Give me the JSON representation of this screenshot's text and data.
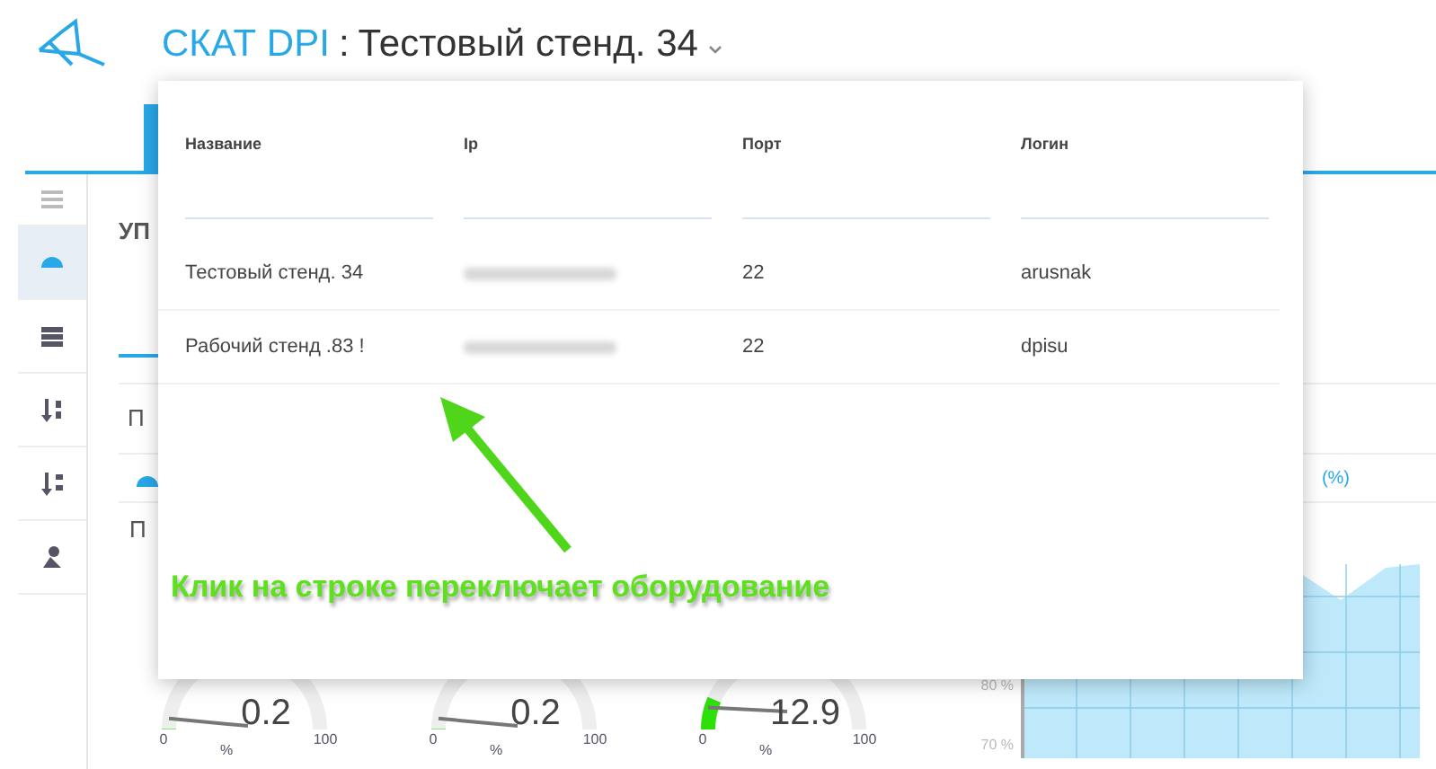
{
  "header": {
    "product": "СКАТ DPI",
    "separator": ":",
    "device": "Тестовый стенд. 34"
  },
  "sidebar": {
    "items": [
      {
        "selected": false
      },
      {
        "selected": true
      },
      {
        "selected": false
      },
      {
        "selected": false
      },
      {
        "selected": false
      },
      {
        "selected": false
      }
    ]
  },
  "page": {
    "heading": "УП",
    "subtab": "П",
    "section": "П",
    "chart_legend": "(%)",
    "gauges": [
      {
        "value": "0.2",
        "min": "0",
        "max": "100",
        "unit": "%"
      },
      {
        "value": "0.2",
        "min": "0",
        "max": "100",
        "unit": "%"
      },
      {
        "value": "12.9",
        "min": "0",
        "max": "100",
        "unit": "%"
      }
    ],
    "chart_axis_labels": [
      "80 %",
      "70 %"
    ]
  },
  "device_menu": {
    "columns": [
      "Название",
      "Ip",
      "Порт",
      "Логин"
    ],
    "rows": [
      {
        "name": "Тестовый стенд. 34",
        "port": "22",
        "login": "arusnak"
      },
      {
        "name": "Рабочий стенд .83 !",
        "port": "22",
        "login": "dpisu"
      }
    ]
  },
  "annotation": "Клик на строке переключает оборудование"
}
